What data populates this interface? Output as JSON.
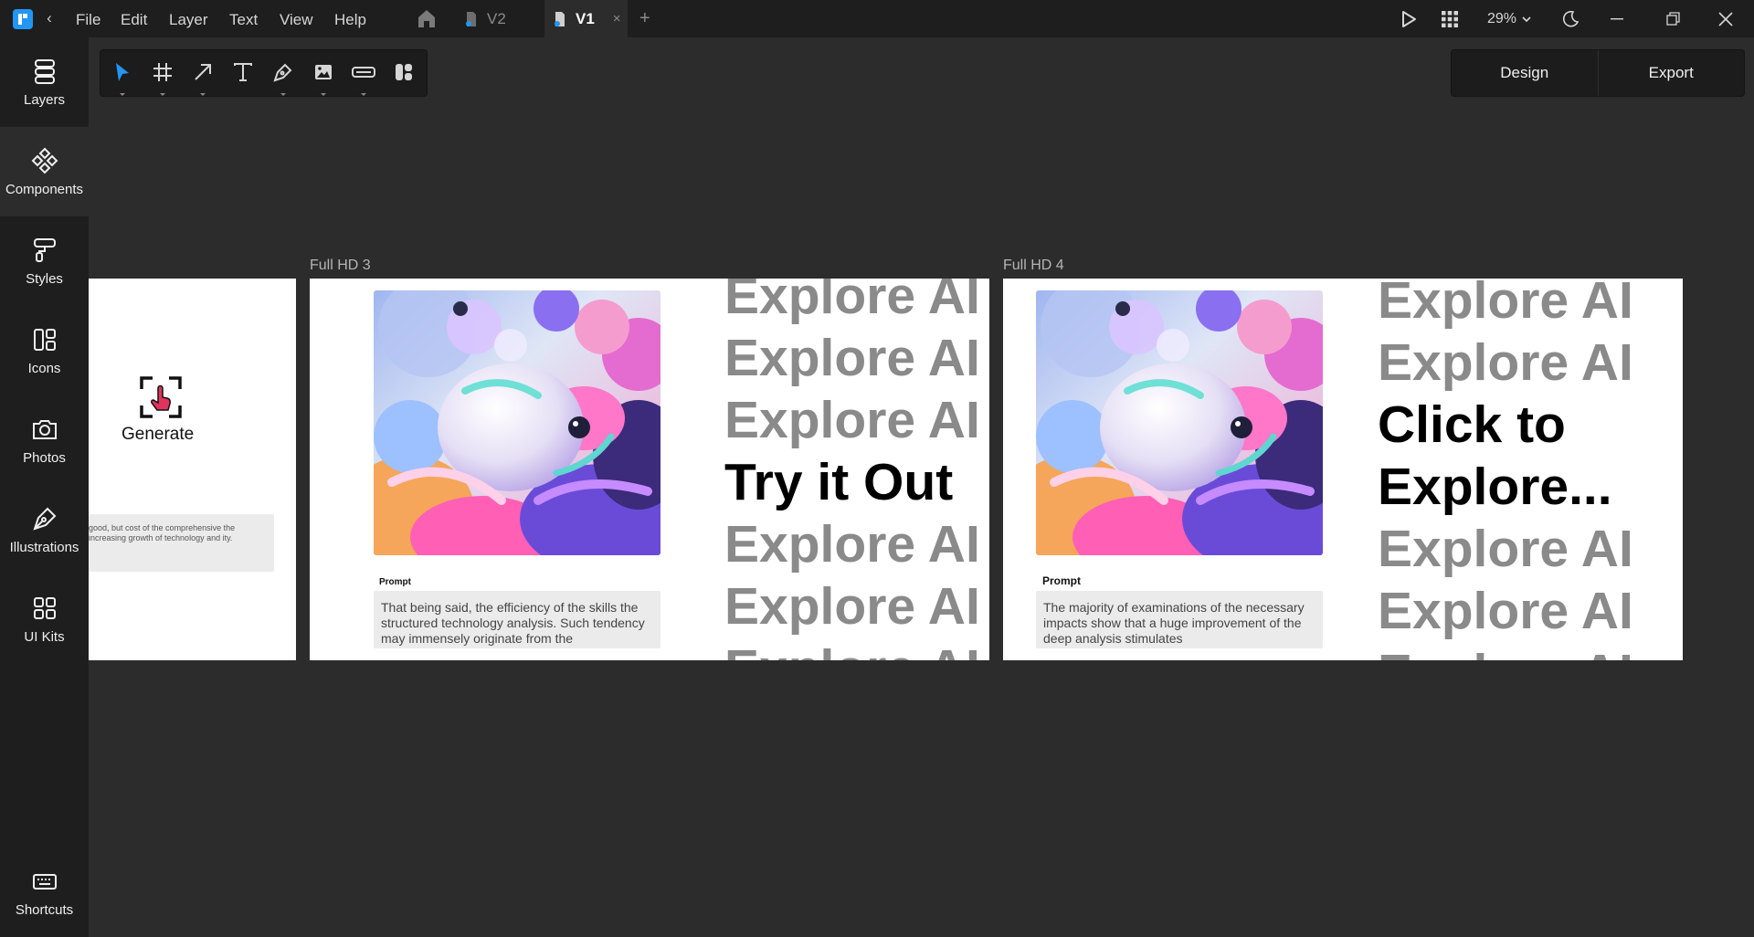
{
  "menu": {
    "file": "File",
    "edit": "Edit",
    "layer": "Layer",
    "text": "Text",
    "view": "View",
    "help": "Help"
  },
  "tabs": {
    "v2": "V2",
    "v1": "V1",
    "close": "×",
    "add": "+"
  },
  "titlebar_right": {
    "zoom": "29%"
  },
  "sidebar": {
    "items": [
      {
        "label": "Layers"
      },
      {
        "label": "Components"
      },
      {
        "label": "Styles"
      },
      {
        "label": "Icons"
      },
      {
        "label": "Photos"
      },
      {
        "label": "Illustrations"
      },
      {
        "label": "UI Kits"
      }
    ],
    "shortcuts": "Shortcuts"
  },
  "modes": {
    "design": "Design",
    "export": "Export"
  },
  "canvas": {
    "left_frame": {
      "generate": "Generate",
      "prompt_text": "good, but cost of the comprehensive the increasing growth of technology and ity."
    },
    "frame3": {
      "label": "Full HD 3",
      "prompt_label": "Prompt",
      "prompt_text": "That being said, the efficiency of the skills the structured technology analysis. Such tendency may immensely originate from the",
      "lines": [
        "Explore AI",
        "Explore AI",
        "Explore AI",
        "Try it Out",
        "Explore AI",
        "Explore AI",
        "Explore AI"
      ]
    },
    "frame4": {
      "label": "Full HD 4",
      "prompt_label": "Prompt",
      "prompt_text": "The majority of examinations of the necessary impacts show that a huge improvement of the deep analysis stimulates",
      "lines": [
        "Explore AI",
        "Explore AI",
        "Click to",
        "Explore...",
        "Explore AI",
        "Explore AI",
        "Explore AI"
      ]
    }
  },
  "colors": {
    "accent": "#2196f3",
    "canvas_bg": "#2c2c2c",
    "panel_bg": "#1e1e1e",
    "muted_text": "#8a8a8a",
    "highlight_text": "#000000"
  }
}
